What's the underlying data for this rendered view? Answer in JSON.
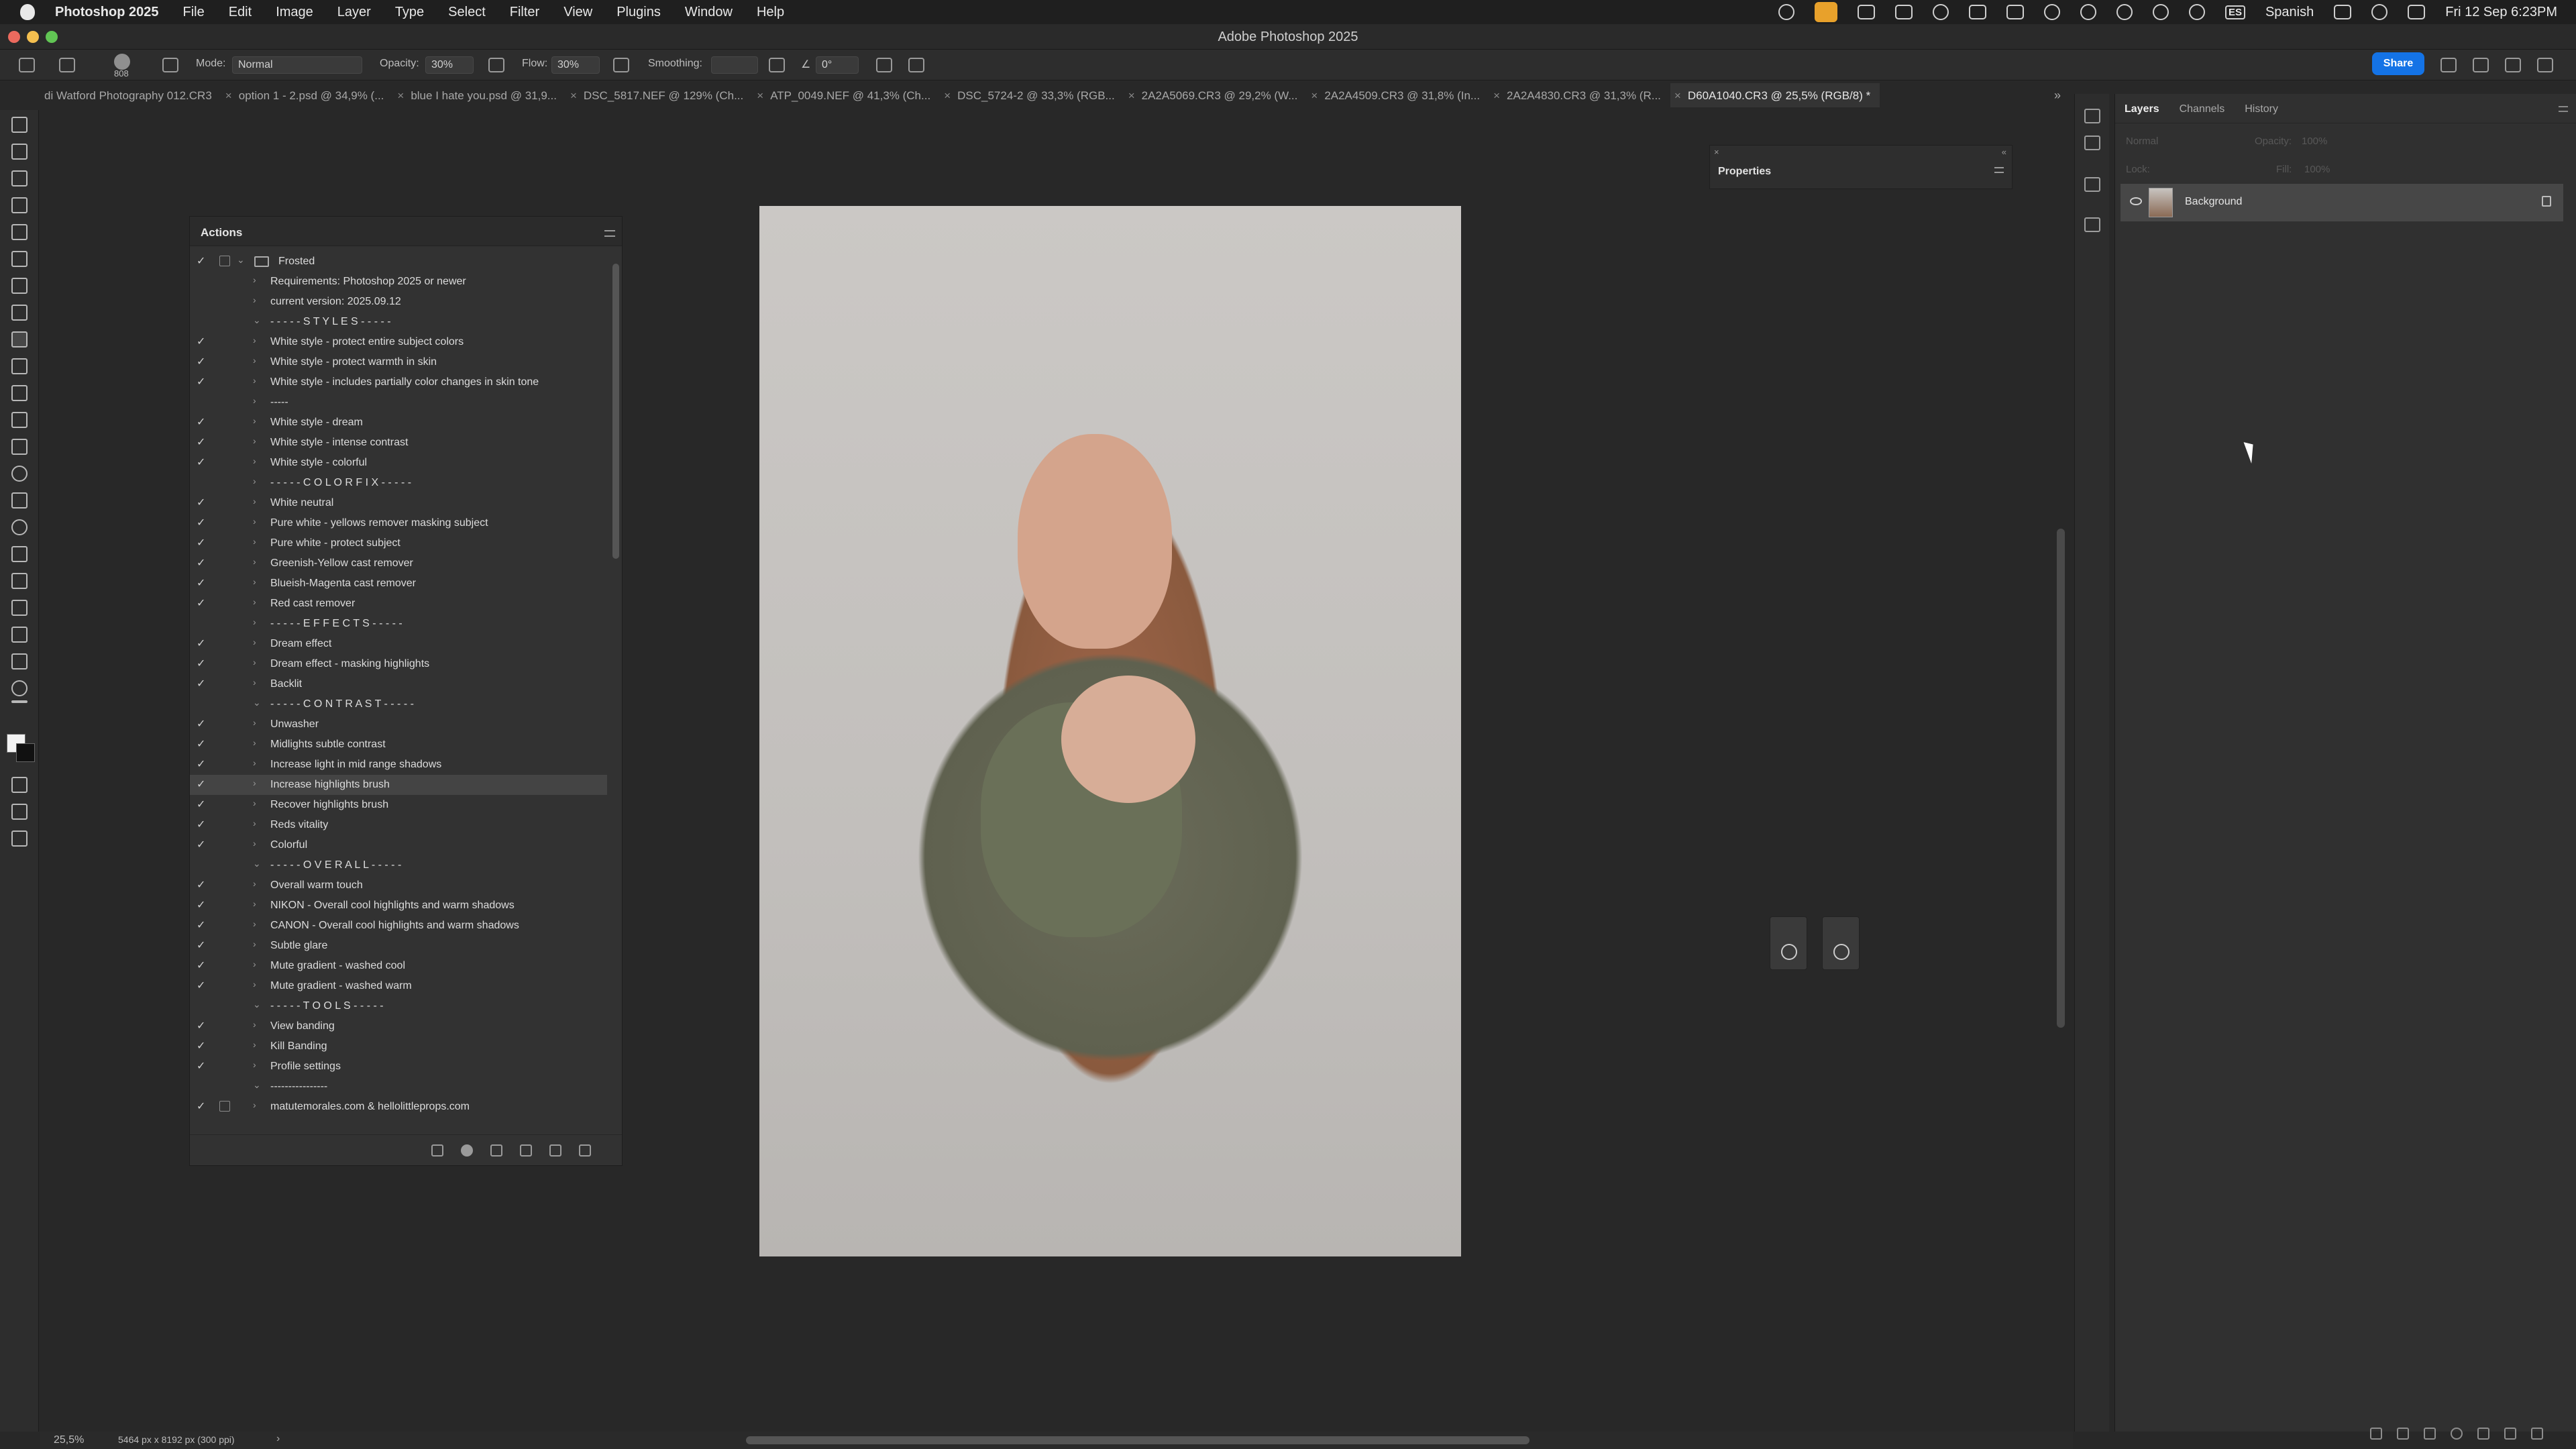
{
  "menubar": {
    "app_name": "Photoshop 2025",
    "items": [
      "File",
      "Edit",
      "Image",
      "Layer",
      "Type",
      "Select",
      "Filter",
      "View",
      "Plugins",
      "Window",
      "Help"
    ],
    "input_source": "ES",
    "language": "Spanish",
    "clock": "Fri 12 Sep  6:23PM"
  },
  "window": {
    "title": "Adobe Photoshop 2025"
  },
  "options_bar": {
    "brush_size": "808",
    "mode_label": "Mode:",
    "mode_value": "Normal",
    "opacity_label": "Opacity:",
    "opacity_value": "30%",
    "flow_label": "Flow:",
    "flow_value": "30%",
    "smoothing_label": "Smoothing:",
    "angle_value": "0°",
    "share_label": "Share"
  },
  "document_tabs": [
    {
      "label": "di Watford Photography 012.CR3"
    },
    {
      "label": "option 1 - 2.psd @ 34,9% (..."
    },
    {
      "label": "blue I hate you.psd @ 31,9..."
    },
    {
      "label": "DSC_5817.NEF @ 129% (Ch..."
    },
    {
      "label": "ATP_0049.NEF @ 41,3% (Ch..."
    },
    {
      "label": "DSC_5724-2 @ 33,3% (RGB..."
    },
    {
      "label": "2A2A5069.CR3 @ 29,2% (W..."
    },
    {
      "label": "2A2A4509.CR3 @ 31,8% (In..."
    },
    {
      "label": "2A2A4830.CR3 @ 31,3% (R..."
    },
    {
      "label": "D60A1040.CR3 @ 25,5% (RGB/8) *",
      "active": true
    }
  ],
  "actions_panel": {
    "title": "Actions",
    "set_name": "Frosted",
    "rows": [
      {
        "label": "Requirements: Photoshop 2025 or newer",
        "checked": false,
        "expanded": false
      },
      {
        "label": "current version: 2025.09.12",
        "checked": false,
        "expanded": false
      },
      {
        "label": "- - - - - S T Y L E S - - - - -",
        "checked": false,
        "expanded": true
      },
      {
        "label": "White style - protect entire subject colors",
        "checked": true,
        "expanded": false
      },
      {
        "label": "White style - protect warmth in skin",
        "checked": true,
        "expanded": false
      },
      {
        "label": "White style - includes partially color changes in skin tone",
        "checked": true,
        "expanded": false
      },
      {
        "label": "-----",
        "checked": false,
        "expanded": false
      },
      {
        "label": "White style - dream",
        "checked": true,
        "expanded": false
      },
      {
        "label": "White style - intense contrast",
        "checked": true,
        "expanded": false
      },
      {
        "label": "White style - colorful",
        "checked": true,
        "expanded": false
      },
      {
        "label": "- - - - - C O L O R  F I X - - - - -",
        "checked": false,
        "expanded": false
      },
      {
        "label": "White neutral",
        "checked": true,
        "expanded": false
      },
      {
        "label": "Pure white - yellows remover masking subject",
        "checked": true,
        "expanded": false
      },
      {
        "label": "Pure white - protect subject",
        "checked": true,
        "expanded": false
      },
      {
        "label": "Greenish-Yellow cast remover",
        "checked": true,
        "expanded": false
      },
      {
        "label": "Blueish-Magenta cast remover",
        "checked": true,
        "expanded": false
      },
      {
        "label": "Red cast remover",
        "checked": true,
        "expanded": false
      },
      {
        "label": "- - - - - E F F E C T S - - - - -",
        "checked": false,
        "expanded": false
      },
      {
        "label": "Dream effect",
        "checked": true,
        "expanded": false
      },
      {
        "label": "Dream effect - masking highlights",
        "checked": true,
        "expanded": false
      },
      {
        "label": "Backlit",
        "checked": true,
        "expanded": false
      },
      {
        "label": "- - - - - C O N T R A S T - - - - -",
        "checked": false,
        "expanded": true
      },
      {
        "label": "Unwasher",
        "checked": true,
        "expanded": false
      },
      {
        "label": "Midlights subtle contrast",
        "checked": true,
        "expanded": false
      },
      {
        "label": "Increase light in mid range shadows",
        "checked": true,
        "expanded": false
      },
      {
        "label": "Increase highlights brush",
        "checked": true,
        "expanded": false,
        "selected": true
      },
      {
        "label": "Recover highlights brush",
        "checked": true,
        "expanded": false
      },
      {
        "label": "Reds vitality",
        "checked": true,
        "expanded": false
      },
      {
        "label": "Colorful",
        "checked": true,
        "expanded": false
      },
      {
        "label": "- - - - - O V E R A L L - - - - -",
        "checked": false,
        "expanded": true
      },
      {
        "label": "Overall warm touch",
        "checked": true,
        "expanded": false
      },
      {
        "label": "NIKON - Overall cool highlights and warm shadows",
        "checked": true,
        "expanded": false
      },
      {
        "label": "CANON - Overall cool highlights and warm shadows",
        "checked": true,
        "expanded": false
      },
      {
        "label": "Subtle glare",
        "checked": true,
        "expanded": false
      },
      {
        "label": "Mute gradient - washed cool",
        "checked": true,
        "expanded": false
      },
      {
        "label": "Mute gradient - washed warm",
        "checked": true,
        "expanded": false
      },
      {
        "label": "- - - - - T O O L S - - - - -",
        "checked": false,
        "expanded": true
      },
      {
        "label": "View banding",
        "checked": true,
        "expanded": false
      },
      {
        "label": "Kill Banding",
        "checked": true,
        "expanded": false
      },
      {
        "label": "Profile settings",
        "checked": true,
        "expanded": false
      },
      {
        "label": "----------------",
        "checked": false,
        "expanded": true
      }
    ],
    "second_set_name": "matutemorales.com & hellolittleprops.com"
  },
  "properties_panel": {
    "title": "Properties"
  },
  "layers_panel": {
    "tabs": [
      "Layers",
      "Channels",
      "History"
    ],
    "blend_mode": "Normal",
    "opacity_label": "Opacity:",
    "opacity_value": "100%",
    "lock_label": "Lock:",
    "fill_label": "Fill:",
    "fill_value": "100%",
    "layer_name": "Background"
  },
  "status_bar": {
    "zoom": "25,5%",
    "doc_info": "5464 px x 8192 px (300 ppi)"
  },
  "colors": {
    "accent": "#1473e6",
    "canvas_bg": "#282828",
    "panel_bg": "#323232"
  }
}
